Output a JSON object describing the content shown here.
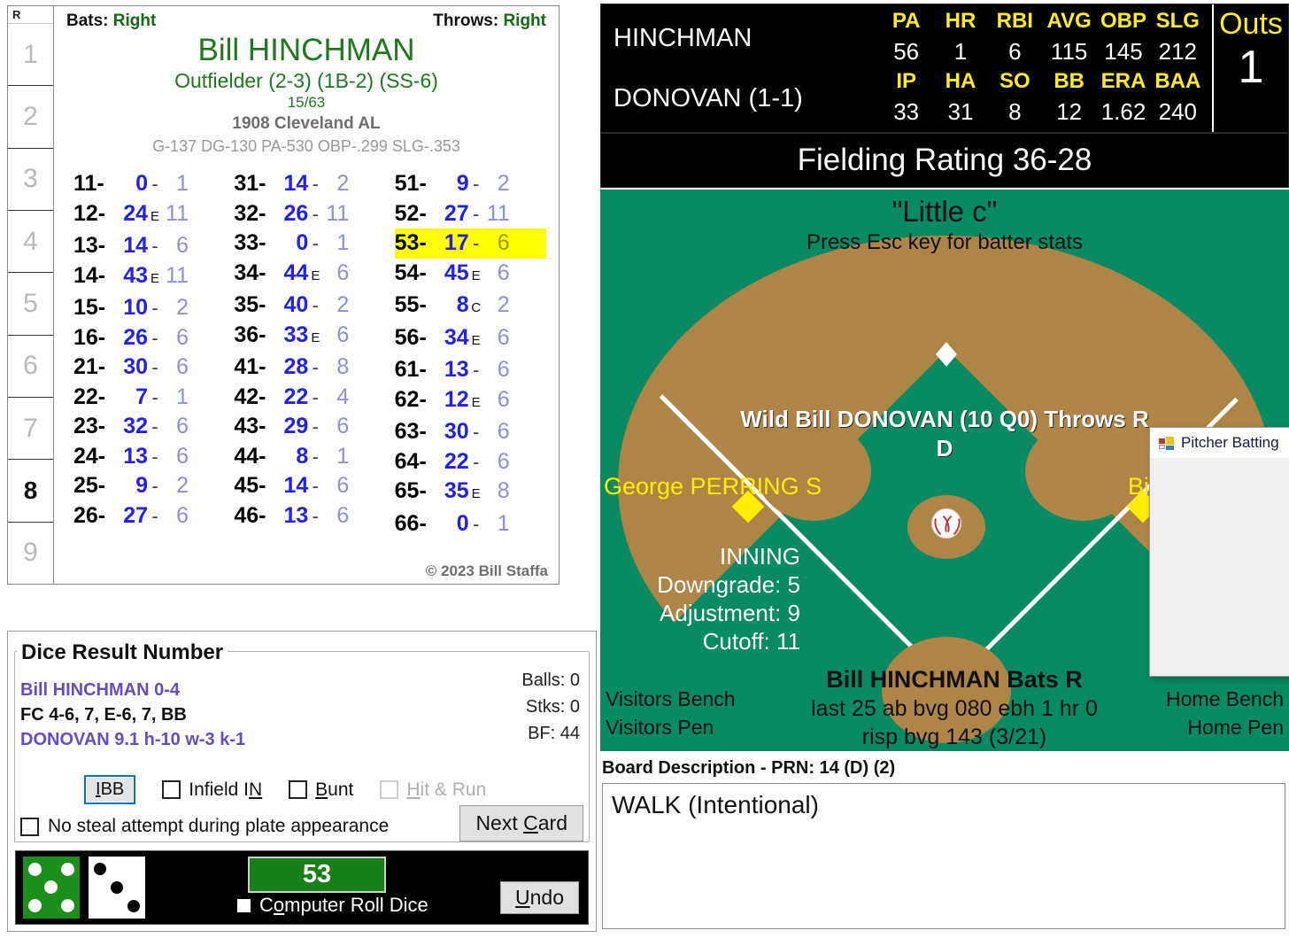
{
  "card": {
    "bats_label": "Bats:",
    "bats_value": "Right",
    "throws_label": "Throws:",
    "throws_value": "Right",
    "player_name": "Bill HINCHMAN",
    "position_line": "Outfielder (2-3) (1B-2) (SS-6)",
    "fraction": "15/63",
    "team_year": "1908 Cleveland AL",
    "season_stats": "G-137 DG-130 PA-530 OBP-.299 SLG-.353",
    "copyright": "© 2023 Bill Staffa",
    "inning_header": "R",
    "innings": [
      "1",
      "2",
      "3",
      "4",
      "5",
      "6",
      "7",
      "8",
      "9"
    ],
    "current_inning": "8",
    "dice_columns": [
      [
        {
          "key": "11-",
          "result": "0",
          "mod": "-",
          "field": "1"
        },
        {
          "key": "12-",
          "result": "24",
          "mod": "E",
          "field": "11"
        },
        {
          "key": "13-",
          "result": "14",
          "mod": "-",
          "field": "6"
        },
        {
          "key": "14-",
          "result": "43",
          "mod": "E",
          "field": "11"
        },
        {
          "key": "15-",
          "result": "10",
          "mod": "-",
          "field": "2"
        },
        {
          "key": "16-",
          "result": "26",
          "mod": "-",
          "field": "6"
        },
        {
          "key": "21-",
          "result": "30",
          "mod": "-",
          "field": "6"
        },
        {
          "key": "22-",
          "result": "7",
          "mod": "-",
          "field": "1"
        },
        {
          "key": "23-",
          "result": "32",
          "mod": "-",
          "field": "6"
        },
        {
          "key": "24-",
          "result": "13",
          "mod": "-",
          "field": "6"
        },
        {
          "key": "25-",
          "result": "9",
          "mod": "-",
          "field": "2"
        },
        {
          "key": "26-",
          "result": "27",
          "mod": "-",
          "field": "6"
        }
      ],
      [
        {
          "key": "31-",
          "result": "14",
          "mod": "-",
          "field": "2"
        },
        {
          "key": "32-",
          "result": "26",
          "mod": "-",
          "field": "11"
        },
        {
          "key": "33-",
          "result": "0",
          "mod": "-",
          "field": "1"
        },
        {
          "key": "34-",
          "result": "44",
          "mod": "E",
          "field": "6"
        },
        {
          "key": "35-",
          "result": "40",
          "mod": "-",
          "field": "2"
        },
        {
          "key": "36-",
          "result": "33",
          "mod": "E",
          "field": "6"
        },
        {
          "key": "41-",
          "result": "28",
          "mod": "-",
          "field": "8"
        },
        {
          "key": "42-",
          "result": "22",
          "mod": "-",
          "field": "4"
        },
        {
          "key": "43-",
          "result": "29",
          "mod": "-",
          "field": "6"
        },
        {
          "key": "44-",
          "result": "8",
          "mod": "-",
          "field": "1"
        },
        {
          "key": "45-",
          "result": "14",
          "mod": "-",
          "field": "6"
        },
        {
          "key": "46-",
          "result": "13",
          "mod": "-",
          "field": "6"
        }
      ],
      [
        {
          "key": "51-",
          "result": "9",
          "mod": "-",
          "field": "2"
        },
        {
          "key": "52-",
          "result": "27",
          "mod": "-",
          "field": "11"
        },
        {
          "key": "53-",
          "result": "17",
          "mod": "-",
          "field": "6",
          "highlight": true
        },
        {
          "key": "54-",
          "result": "45",
          "mod": "E",
          "field": "6"
        },
        {
          "key": "55-",
          "result": "8",
          "mod": "C",
          "field": "2"
        },
        {
          "key": "56-",
          "result": "34",
          "mod": "E",
          "field": "6"
        },
        {
          "key": "61-",
          "result": "13",
          "mod": "-",
          "field": "6"
        },
        {
          "key": "62-",
          "result": "12",
          "mod": "E",
          "field": "6"
        },
        {
          "key": "63-",
          "result": "30",
          "mod": "-",
          "field": "6"
        },
        {
          "key": "64-",
          "result": "22",
          "mod": "-",
          "field": "6"
        },
        {
          "key": "65-",
          "result": "35",
          "mod": "E",
          "field": "8"
        },
        {
          "key": "66-",
          "result": "0",
          "mod": "-",
          "field": "1"
        }
      ]
    ]
  },
  "dice_panel": {
    "group_title": "Dice Result Number",
    "line_batter": "Bill HINCHMAN  0-4",
    "line_result": "FC 4-6, 7, E-6, 7, BB",
    "line_pitcher": "DONOVAN  9.1  h-10  w-3  k-1",
    "balls": "Balls: 0",
    "strikes": "Stks: 0",
    "bf": "BF: 44",
    "ibb_label": "IBB",
    "infield_in_label": "Infield IN",
    "bunt_label": "Bunt",
    "hit_and_run_label": "Hit & Run",
    "no_steal_label": "No steal attempt during plate appearance",
    "next_card_label": "Next Card",
    "roll_total": "53",
    "computer_roll_label": "Computer Roll Dice",
    "undo_label": "Undo",
    "die_green_value": 5,
    "die_white_value": 3
  },
  "scoreboard": {
    "batter_name": "HINCHMAN",
    "batter_headers": [
      "PA",
      "HR",
      "RBI",
      "AVG",
      "OBP",
      "SLG"
    ],
    "batter_values": [
      "56",
      "1",
      "6",
      "115",
      "145",
      "212"
    ],
    "pitcher_name": "DONOVAN (1-1)",
    "pitcher_headers": [
      "IP",
      "HA",
      "SO",
      "BB",
      "ERA",
      "BAA"
    ],
    "pitcher_values": [
      "33",
      "31",
      "8",
      "12",
      "1.62",
      "240"
    ],
    "outs_label": "Outs",
    "outs_value": "1",
    "fielding_rating": "Fielding Rating 36-28"
  },
  "field": {
    "stadium_name": "\"Little c\"",
    "esc_hint": "Press Esc key for batter stats",
    "pitcher_line": "Wild Bill DONOVAN (10 Q0) Throws R",
    "pitcher_line2": "D",
    "shortstop": "George PERRING S",
    "firstbase": "Bill H",
    "inning_title": "INNING",
    "downgrade": "Downgrade: 5",
    "adjustment": "Adjustment: 9",
    "cutoff": "Cutoff: 11",
    "batter_line": "Bill HINCHMAN Bats R",
    "batter_last25": "last 25 ab bvg 080 ebh 1 hr 0",
    "batter_risp": "risp bvg 143 (3/21)",
    "visitors_bench": "Visitors Bench",
    "visitors_pen": "Visitors Pen",
    "home_bench": "Home Bench",
    "home_pen": "Home Pen"
  },
  "dialog": {
    "title": "Pitcher Batting"
  },
  "board": {
    "title": "Board Description - PRN: 14 (D) (2)",
    "text": "WALK (Intentional)"
  },
  "colors": {
    "field_green": "#088a62",
    "field_dirt": "#ae8546",
    "highlight_yellow": "#ffff00",
    "accent_green": "#1d7a1d",
    "base_yellow": "#ffee00"
  }
}
